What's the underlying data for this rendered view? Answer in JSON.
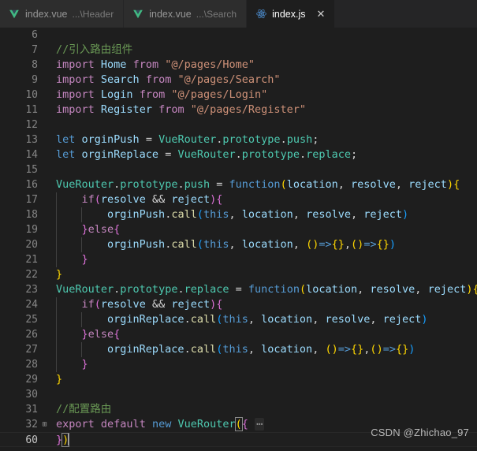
{
  "window": {
    "app": "Visual Studio Code",
    "theme_bg": "#1e1e1e",
    "tabbar_bg": "#252526"
  },
  "tabs": [
    {
      "title": "index.vue",
      "description": "...\\Header",
      "icon": "vue-icon",
      "active": false,
      "closable": false
    },
    {
      "title": "index.vue",
      "description": "...\\Search",
      "icon": "vue-icon",
      "active": false,
      "closable": false
    },
    {
      "title": "index.js",
      "description": "",
      "icon": "react-js-icon",
      "active": true,
      "closable": true,
      "close_label": "✕"
    }
  ],
  "editor": {
    "language": "javascript",
    "current_line": 60,
    "fold_marker": "⋯",
    "fold_expand_icon": "⊞",
    "lines": [
      {
        "n": 6,
        "text": ""
      },
      {
        "n": 7,
        "text": "//引入路由组件"
      },
      {
        "n": 8,
        "text": "import Home from \"@/pages/Home\""
      },
      {
        "n": 9,
        "text": "import Search from \"@/pages/Search\""
      },
      {
        "n": 10,
        "text": "import Login from \"@/pages/Login\""
      },
      {
        "n": 11,
        "text": "import Register from \"@/pages/Register\""
      },
      {
        "n": 12,
        "text": ""
      },
      {
        "n": 13,
        "text": "let orginPush = VueRouter.prototype.push;"
      },
      {
        "n": 14,
        "text": "let orginReplace = VueRouter.prototype.replace;"
      },
      {
        "n": 15,
        "text": ""
      },
      {
        "n": 16,
        "text": "VueRouter.prototype.push = function(location, resolve, reject){"
      },
      {
        "n": 17,
        "text": "    if(resolve && reject){"
      },
      {
        "n": 18,
        "text": "        orginPush.call(this, location, resolve, reject)"
      },
      {
        "n": 19,
        "text": "    }else{"
      },
      {
        "n": 20,
        "text": "        orginPush.call(this, location, ()=>{},()=>{})"
      },
      {
        "n": 21,
        "text": "    }"
      },
      {
        "n": 22,
        "text": "}"
      },
      {
        "n": 23,
        "text": "VueRouter.prototype.replace = function(location, resolve, reject){"
      },
      {
        "n": 24,
        "text": "    if(resolve && reject){"
      },
      {
        "n": 25,
        "text": "        orginReplace.call(this, location, resolve, reject)"
      },
      {
        "n": 26,
        "text": "    }else{"
      },
      {
        "n": 27,
        "text": "        orginReplace.call(this, location, ()=>{},()=>{})"
      },
      {
        "n": 28,
        "text": "    }"
      },
      {
        "n": 29,
        "text": "}"
      },
      {
        "n": 30,
        "text": ""
      },
      {
        "n": 31,
        "text": "//配置路由"
      },
      {
        "n": 32,
        "text": "export default new VueRouter({ ⋯",
        "folded": true
      },
      {
        "n": 60,
        "text": "})",
        "current": true
      }
    ]
  },
  "watermark": {
    "text": "CSDN @Zhichao_97"
  },
  "colors": {
    "comment": "#6a9955",
    "keyword": "#c586c0",
    "control_blue": "#569cd6",
    "variable": "#9cdcfe",
    "string": "#ce9178",
    "class": "#4ec9b0",
    "plain": "#d4d4d4",
    "line_number": "#858585",
    "editor_bg": "#1e1e1e",
    "tab_inactive_bg": "#2d2d2d",
    "tab_active_bg": "#1e1e1e"
  }
}
